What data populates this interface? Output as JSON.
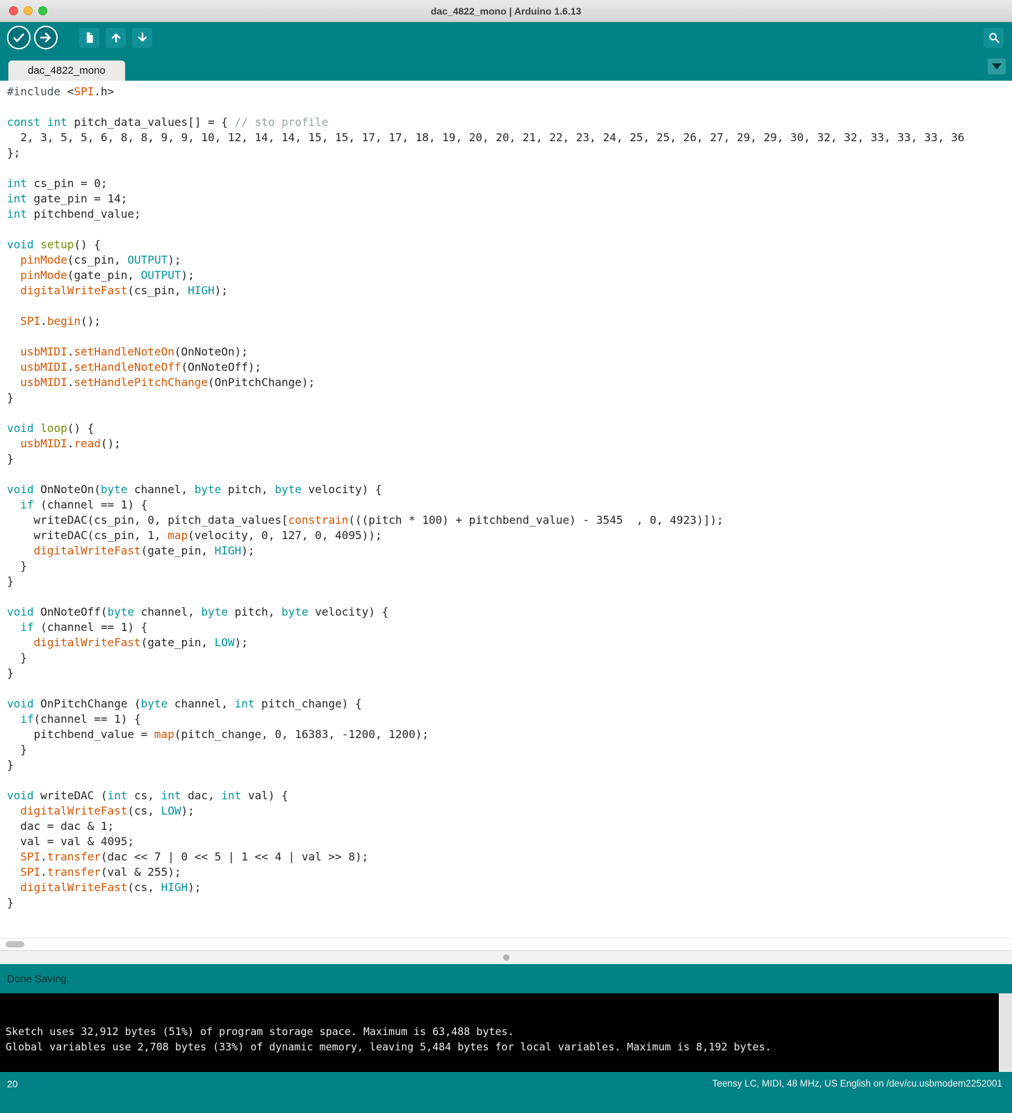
{
  "colors": {
    "teal_bar": "#008286",
    "teal_button": "#129097",
    "teal_button_dark": "#007179",
    "keyword_teal": "#00979C",
    "function_orange": "#D35400",
    "func_green": "#728E00",
    "comment_gray": "#95A5A6",
    "include_dark": "#434F54",
    "plain_code": "#262626",
    "status_text": "#0A2F31",
    "console_text": "#EDEDED"
  },
  "titlebar": {
    "title": "dac_4822_mono | Arduino 1.6.13",
    "traffic_lights": [
      "close",
      "minimize",
      "zoom"
    ]
  },
  "toolbar": {
    "buttons": [
      {
        "name": "verify",
        "icon": "checkmark-icon"
      },
      {
        "name": "upload",
        "icon": "right-arrow-icon"
      },
      {
        "name": "new-sketch",
        "icon": "document-icon"
      },
      {
        "name": "open",
        "icon": "up-arrow-icon"
      },
      {
        "name": "save",
        "icon": "down-arrow-icon"
      }
    ],
    "serial_monitor": {
      "name": "serial-monitor",
      "icon": "magnifier-icon"
    }
  },
  "tabbar": {
    "active_tab": "dac_4822_mono",
    "dropdown_icon": "chevron-down-icon"
  },
  "editor": {
    "lines": [
      [
        [
          "d",
          "#include"
        ],
        [
          "p",
          " <"
        ],
        [
          "f",
          "SPI"
        ],
        [
          "p",
          ".h>"
        ]
      ],
      [],
      [
        [
          "k",
          "const"
        ],
        [
          "p",
          " "
        ],
        [
          "k",
          "int"
        ],
        [
          "p",
          " pitch_data_values[] = { "
        ],
        [
          "c",
          "// sto profile"
        ]
      ],
      [
        [
          "p",
          "  2, 3, 5, 5, 6, 8, 8, 9, 9, 10, 12, 14, 14, 15, 15, 17, 17, 18, 19, 20, 20, 21, 22, 23, 24, 25, 25, 26, 27, 29, 29, 30, 32, 32, 33, 33, 33, 36"
        ]
      ],
      [
        [
          "p",
          "};"
        ]
      ],
      [],
      [
        [
          "k",
          "int"
        ],
        [
          "p",
          " cs_pin = 0;"
        ]
      ],
      [
        [
          "k",
          "int"
        ],
        [
          "p",
          " gate_pin = 14;"
        ]
      ],
      [
        [
          "k",
          "int"
        ],
        [
          "p",
          " pitchbend_value;"
        ]
      ],
      [],
      [
        [
          "k",
          "void"
        ],
        [
          "p",
          " "
        ],
        [
          "g",
          "setup"
        ],
        [
          "p",
          "() {"
        ]
      ],
      [
        [
          "p",
          "  "
        ],
        [
          "f",
          "pinMode"
        ],
        [
          "p",
          "(cs_pin, "
        ],
        [
          "k",
          "OUTPUT"
        ],
        [
          "p",
          ");"
        ]
      ],
      [
        [
          "p",
          "  "
        ],
        [
          "f",
          "pinMode"
        ],
        [
          "p",
          "(gate_pin, "
        ],
        [
          "k",
          "OUTPUT"
        ],
        [
          "p",
          ");"
        ]
      ],
      [
        [
          "p",
          "  "
        ],
        [
          "f",
          "digitalWriteFast"
        ],
        [
          "p",
          "(cs_pin, "
        ],
        [
          "k",
          "HIGH"
        ],
        [
          "p",
          ");"
        ]
      ],
      [],
      [
        [
          "p",
          "  "
        ],
        [
          "f",
          "SPI"
        ],
        [
          "p",
          "."
        ],
        [
          "f",
          "begin"
        ],
        [
          "p",
          "();"
        ]
      ],
      [],
      [
        [
          "p",
          "  "
        ],
        [
          "f",
          "usbMIDI"
        ],
        [
          "p",
          "."
        ],
        [
          "f",
          "setHandleNoteOn"
        ],
        [
          "p",
          "(OnNoteOn);"
        ]
      ],
      [
        [
          "p",
          "  "
        ],
        [
          "f",
          "usbMIDI"
        ],
        [
          "p",
          "."
        ],
        [
          "f",
          "setHandleNoteOff"
        ],
        [
          "p",
          "(OnNoteOff);"
        ]
      ],
      [
        [
          "p",
          "  "
        ],
        [
          "f",
          "usbMIDI"
        ],
        [
          "p",
          "."
        ],
        [
          "f",
          "setHandlePitchChange"
        ],
        [
          "p",
          "(OnPitchChange);"
        ]
      ],
      [
        [
          "p",
          "}"
        ]
      ],
      [],
      [
        [
          "k",
          "void"
        ],
        [
          "p",
          " "
        ],
        [
          "g",
          "loop"
        ],
        [
          "p",
          "() {"
        ]
      ],
      [
        [
          "p",
          "  "
        ],
        [
          "f",
          "usbMIDI"
        ],
        [
          "p",
          "."
        ],
        [
          "f",
          "read"
        ],
        [
          "p",
          "();"
        ]
      ],
      [
        [
          "p",
          "}"
        ]
      ],
      [],
      [
        [
          "k",
          "void"
        ],
        [
          "p",
          " OnNoteOn("
        ],
        [
          "k",
          "byte"
        ],
        [
          "p",
          " channel, "
        ],
        [
          "k",
          "byte"
        ],
        [
          "p",
          " pitch, "
        ],
        [
          "k",
          "byte"
        ],
        [
          "p",
          " velocity) {"
        ]
      ],
      [
        [
          "p",
          "  "
        ],
        [
          "k",
          "if"
        ],
        [
          "p",
          " (channel == 1) {"
        ]
      ],
      [
        [
          "p",
          "    writeDAC(cs_pin, 0, pitch_data_values["
        ],
        [
          "f",
          "constrain"
        ],
        [
          "p",
          "(((pitch * 100) + pitchbend_value) - 3545  , 0, 4923)]);"
        ]
      ],
      [
        [
          "p",
          "    writeDAC(cs_pin, 1, "
        ],
        [
          "f",
          "map"
        ],
        [
          "p",
          "(velocity, 0, 127, 0, 4095));"
        ]
      ],
      [
        [
          "p",
          "    "
        ],
        [
          "f",
          "digitalWriteFast"
        ],
        [
          "p",
          "(gate_pin, "
        ],
        [
          "k",
          "HIGH"
        ],
        [
          "p",
          ");"
        ]
      ],
      [
        [
          "p",
          "  }"
        ]
      ],
      [
        [
          "p",
          "}"
        ]
      ],
      [],
      [
        [
          "k",
          "void"
        ],
        [
          "p",
          " OnNoteOff("
        ],
        [
          "k",
          "byte"
        ],
        [
          "p",
          " channel, "
        ],
        [
          "k",
          "byte"
        ],
        [
          "p",
          " pitch, "
        ],
        [
          "k",
          "byte"
        ],
        [
          "p",
          " velocity) {"
        ]
      ],
      [
        [
          "p",
          "  "
        ],
        [
          "k",
          "if"
        ],
        [
          "p",
          " (channel == 1) {"
        ]
      ],
      [
        [
          "p",
          "    "
        ],
        [
          "f",
          "digitalWriteFast"
        ],
        [
          "p",
          "(gate_pin, "
        ],
        [
          "k",
          "LOW"
        ],
        [
          "p",
          ");"
        ]
      ],
      [
        [
          "p",
          "  }"
        ]
      ],
      [
        [
          "p",
          "}"
        ]
      ],
      [],
      [
        [
          "k",
          "void"
        ],
        [
          "p",
          " OnPitchChange ("
        ],
        [
          "k",
          "byte"
        ],
        [
          "p",
          " channel, "
        ],
        [
          "k",
          "int"
        ],
        [
          "p",
          " pitch_change) {"
        ]
      ],
      [
        [
          "p",
          "  "
        ],
        [
          "k",
          "if"
        ],
        [
          "p",
          "(channel == 1) {"
        ]
      ],
      [
        [
          "p",
          "    pitchbend_value = "
        ],
        [
          "f",
          "map"
        ],
        [
          "p",
          "(pitch_change, 0, 16383, -1200, 1200);"
        ]
      ],
      [
        [
          "p",
          "  }"
        ]
      ],
      [
        [
          "p",
          "}"
        ]
      ],
      [],
      [
        [
          "k",
          "void"
        ],
        [
          "p",
          " writeDAC ("
        ],
        [
          "k",
          "int"
        ],
        [
          "p",
          " cs, "
        ],
        [
          "k",
          "int"
        ],
        [
          "p",
          " dac, "
        ],
        [
          "k",
          "int"
        ],
        [
          "p",
          " val) {"
        ]
      ],
      [
        [
          "p",
          "  "
        ],
        [
          "f",
          "digitalWriteFast"
        ],
        [
          "p",
          "(cs, "
        ],
        [
          "k",
          "LOW"
        ],
        [
          "p",
          ");"
        ]
      ],
      [
        [
          "p",
          "  dac = dac & 1;"
        ]
      ],
      [
        [
          "p",
          "  val = val & 4095;"
        ]
      ],
      [
        [
          "p",
          "  "
        ],
        [
          "f",
          "SPI"
        ],
        [
          "p",
          "."
        ],
        [
          "f",
          "transfer"
        ],
        [
          "p",
          "(dac << 7 | 0 << 5 | 1 << 4 | val >> 8);"
        ]
      ],
      [
        [
          "p",
          "  "
        ],
        [
          "f",
          "SPI"
        ],
        [
          "p",
          "."
        ],
        [
          "f",
          "transfer"
        ],
        [
          "p",
          "(val & 255);"
        ]
      ],
      [
        [
          "p",
          "  "
        ],
        [
          "f",
          "digitalWriteFast"
        ],
        [
          "p",
          "(cs, "
        ],
        [
          "k",
          "HIGH"
        ],
        [
          "p",
          ");"
        ]
      ],
      [
        [
          "p",
          "}"
        ]
      ]
    ]
  },
  "statusbar": {
    "message": "Done Saving."
  },
  "console": {
    "lines": [
      "Sketch uses 32,912 bytes (51%) of program storage space. Maximum is 63,488 bytes.",
      "Global variables use 2,708 bytes (33%) of dynamic memory, leaving 5,484 bytes for local variables. Maximum is 8,192 bytes."
    ]
  },
  "footer": {
    "line_number": "20",
    "board_info": "Teensy LC, MIDI, 48 MHz, US English on /dev/cu.usbmodem2252001"
  }
}
